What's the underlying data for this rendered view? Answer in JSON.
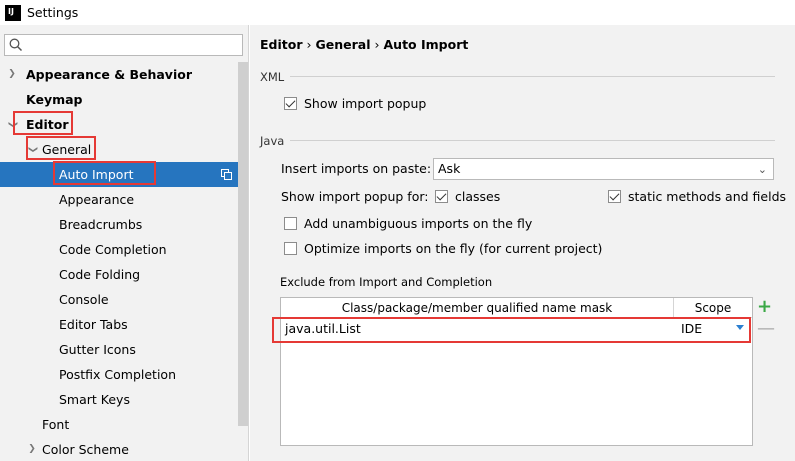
{
  "window": {
    "title": "Settings",
    "app_icon": "IJ"
  },
  "search": {
    "placeholder": "",
    "value": ""
  },
  "tree": [
    {
      "label": "Appearance & Behavior",
      "expanded": false
    },
    {
      "label": "Keymap"
    },
    {
      "label": "Editor",
      "expanded": true
    },
    {
      "label": "General",
      "expanded": true
    },
    {
      "label": "Auto Import",
      "selected": true
    },
    {
      "label": "Appearance"
    },
    {
      "label": "Breadcrumbs"
    },
    {
      "label": "Code Completion"
    },
    {
      "label": "Code Folding"
    },
    {
      "label": "Console"
    },
    {
      "label": "Editor Tabs"
    },
    {
      "label": "Gutter Icons"
    },
    {
      "label": "Postfix Completion"
    },
    {
      "label": "Smart Keys"
    },
    {
      "label": "Font"
    },
    {
      "label": "Color Scheme",
      "expanded": false
    }
  ],
  "breadcrumb": {
    "part1": "Editor",
    "part2": "General",
    "part3": "Auto Import",
    "sep": "›"
  },
  "xml": {
    "section": "XML",
    "show_import_popup": {
      "label": "Show import popup",
      "checked": true
    }
  },
  "java": {
    "section": "Java",
    "insert_imports_label": "Insert imports on paste:",
    "insert_imports_value": "Ask",
    "show_popup_for_label": "Show import popup for:",
    "classes": {
      "label": "classes",
      "checked": true
    },
    "static_methods": {
      "label": "static methods and fields",
      "checked": true
    },
    "add_unambiguous": {
      "label": "Add unambiguous imports on the fly",
      "checked": false
    },
    "optimize_imports": {
      "label": "Optimize imports on the fly (for current project)",
      "checked": false
    }
  },
  "exclude": {
    "section": "Exclude from Import and Completion",
    "columns": [
      "Class/package/member qualified name mask",
      "Scope"
    ],
    "rows": [
      {
        "mask": "java.util.List",
        "scope": "IDE"
      }
    ],
    "add_label": "+",
    "remove_label": "—"
  },
  "colors": {
    "selection": "#2675bf",
    "highlight_border": "#e53935",
    "add_button": "#3aa845",
    "dropdown_arrow": "#2b7fd0"
  }
}
